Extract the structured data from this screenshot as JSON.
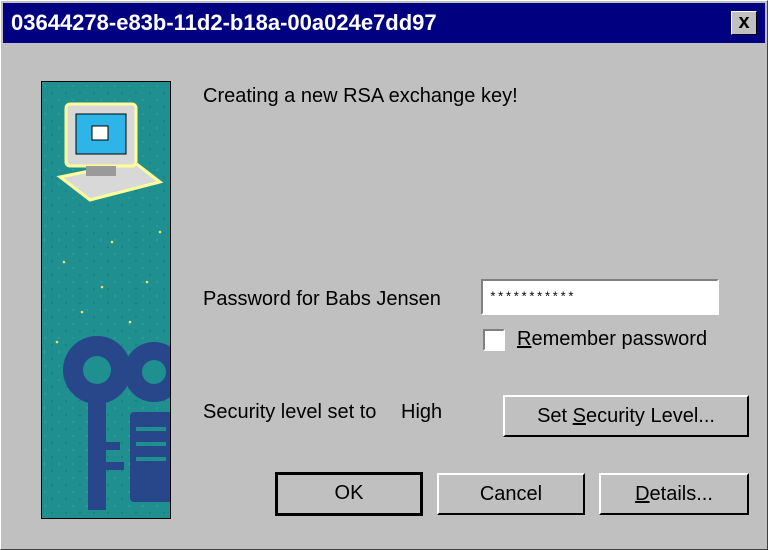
{
  "window": {
    "title": "03644278-e83b-11d2-b18a-00a024e7dd97",
    "close_glyph": "x"
  },
  "dialog": {
    "message": "Creating a new RSA exchange key!",
    "password_label": "Password for Babs Jensen",
    "password_value": "***********",
    "remember_label_first": "R",
    "remember_label_rest": "emember password",
    "remember_checked": false,
    "security_label": "Security level set to",
    "security_value": "High",
    "set_security_pre": "Set ",
    "set_security_key": "S",
    "set_security_post": "ecurity Level...",
    "ok_label": "OK",
    "cancel_label": "Cancel",
    "details_key": "D",
    "details_rest": "etails..."
  },
  "icons": {
    "computer": "computer-icon",
    "keys": "keys-illustration"
  },
  "colors": {
    "titlebar": "#000080",
    "face": "#c0c0c0",
    "panel": "#1f8f8f"
  }
}
